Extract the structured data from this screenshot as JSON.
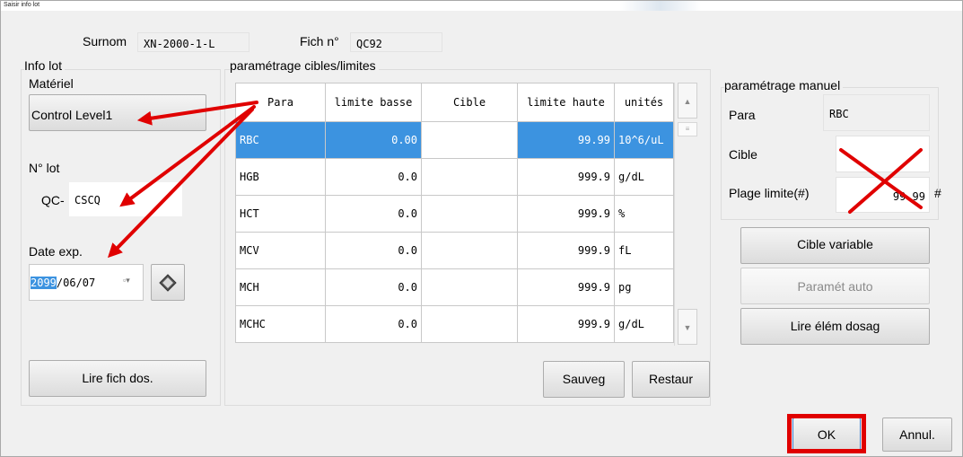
{
  "window": {
    "title": "Saisir info lot"
  },
  "header": {
    "surnom_label": "Surnom",
    "surnom_value": "XN-2000-1-L",
    "fich_label": "Fich n°",
    "fich_value": "QC92"
  },
  "info_lot": {
    "group_label": "Info lot",
    "materiel_label": "Matériel",
    "materiel_value": "Control Level1",
    "lot_label": "N° lot",
    "lot_prefix": "QC-",
    "lot_value": "CSCQ",
    "date_label": "Date exp.",
    "date_year": "2099",
    "date_rest": "/06/07",
    "read_button": "Lire fich dos."
  },
  "params": {
    "group_label": "paramétrage cibles/limites",
    "columns": [
      "Para",
      "limite basse",
      "Cible",
      "limite haute",
      "unités"
    ],
    "rows": [
      {
        "para": "RBC",
        "low": "0.00",
        "target": "",
        "high": "99.99",
        "unit": "10^6/uL"
      },
      {
        "para": "HGB",
        "low": "0.0",
        "target": "",
        "high": "999.9",
        "unit": "g/dL"
      },
      {
        "para": "HCT",
        "low": "0.0",
        "target": "",
        "high": "999.9",
        "unit": "%"
      },
      {
        "para": "MCV",
        "low": "0.0",
        "target": "",
        "high": "999.9",
        "unit": "fL"
      },
      {
        "para": "MCH",
        "low": "0.0",
        "target": "",
        "high": "999.9",
        "unit": "pg"
      },
      {
        "para": "MCHC",
        "low": "0.0",
        "target": "",
        "high": "999.9",
        "unit": "g/dL"
      }
    ],
    "save_button": "Sauveg",
    "restore_button": "Restaur"
  },
  "manual": {
    "group_label": "paramétrage manuel",
    "para_label": "Para",
    "para_value": "RBC",
    "target_label": "Cible",
    "target_value": "",
    "range_label": "Plage limite(#)",
    "range_value": "99.99",
    "range_unit": "#",
    "variable_button": "Cible variable",
    "auto_button": "Paramét auto",
    "read_items_button": "Lire élém dosag"
  },
  "footer": {
    "ok_button": "OK",
    "cancel_button": "Annul."
  },
  "annotations": {
    "arrow_color": "#e00000",
    "highlight_color": "#e00000"
  }
}
